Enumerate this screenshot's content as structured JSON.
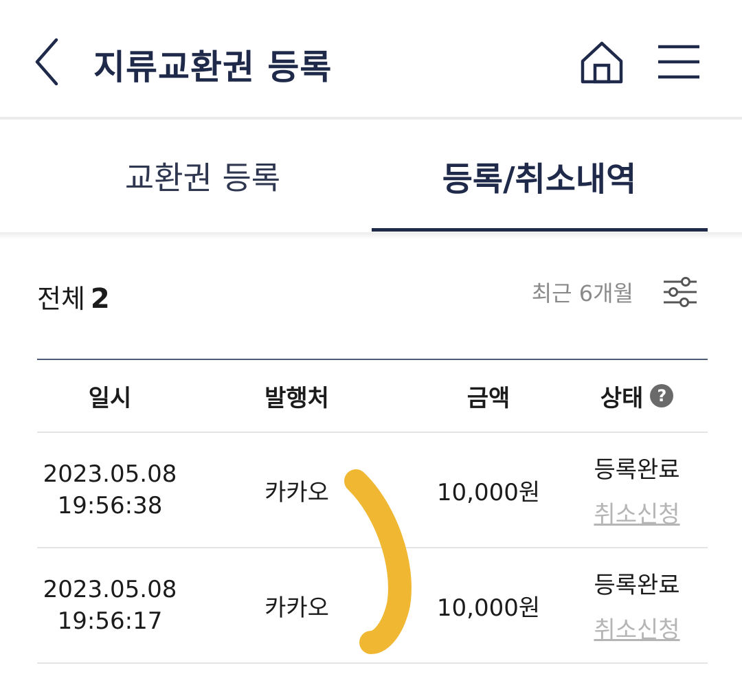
{
  "header": {
    "title": "지류교환권 등록"
  },
  "tabs": [
    {
      "label": "교환권 등록",
      "active": false
    },
    {
      "label": "등록/취소내역",
      "active": true
    }
  ],
  "summary": {
    "total_label": "전체",
    "total_count": "2",
    "period": "최근 6개월"
  },
  "table": {
    "columns": [
      "일시",
      "발행처",
      "금액",
      "상태"
    ],
    "rows": [
      {
        "date": "2023.05.08",
        "time": "19:56:38",
        "issuer": "카카오",
        "amount": "10,000원",
        "status": "등록완료",
        "action": "취소신청"
      },
      {
        "date": "2023.05.08",
        "time": "19:56:17",
        "issuer": "카카오",
        "amount": "10,000원",
        "status": "등록완료",
        "action": "취소신청"
      }
    ]
  },
  "icons": {
    "back": "chevron-left-icon",
    "home": "home-icon",
    "menu": "hamburger-menu-icon",
    "filter": "filter-sliders-icon",
    "help": "question-circle-icon"
  },
  "help_symbol": "?",
  "colors": {
    "primary_navy": "#1f2a4a",
    "muted_text": "#8a8a8a",
    "link_gray": "#b5b5b5",
    "annotation_yellow": "#f0b733"
  }
}
